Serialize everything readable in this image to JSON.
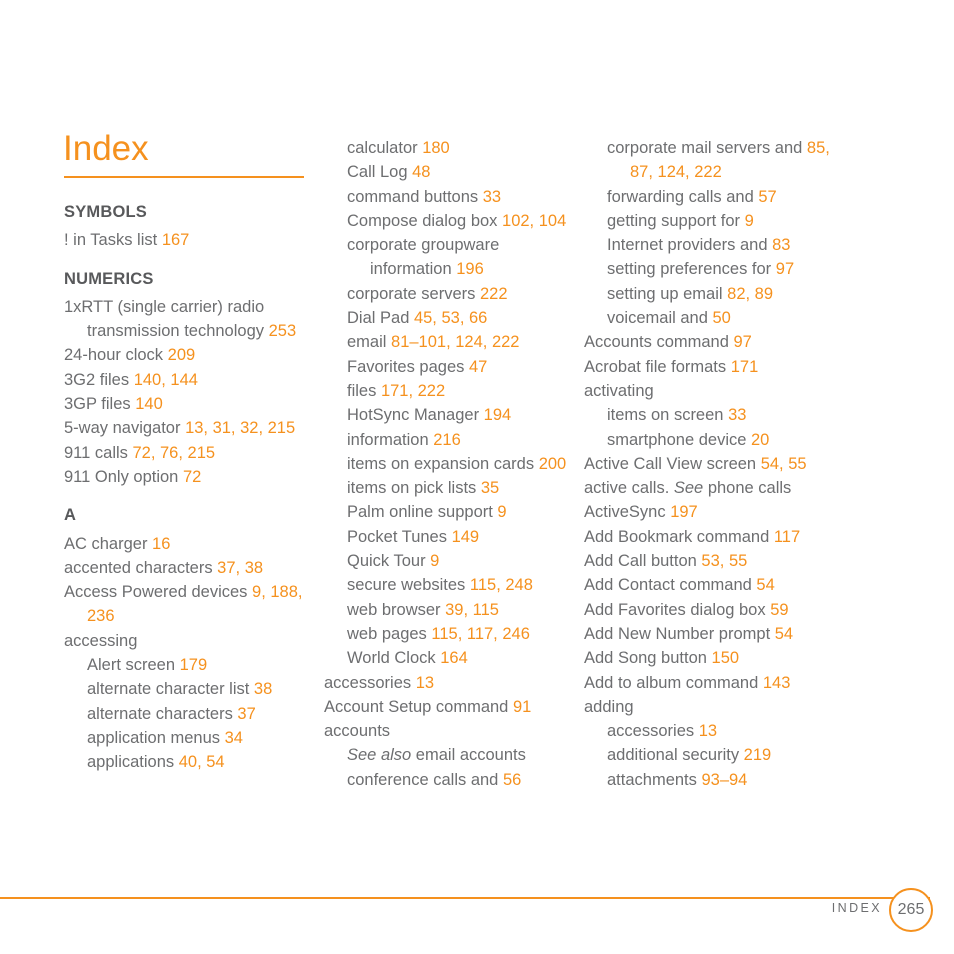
{
  "page": {
    "title": "Index",
    "accent_color": "#f5911e",
    "body_color": "#6d6e70",
    "head_color": "#58595b",
    "background": "#ffffff"
  },
  "footer": {
    "label": "INDEX",
    "page_number": "265"
  },
  "columns": [
    {
      "id": "column-1",
      "blocks": [
        {
          "type": "section",
          "label": "SYMBOLS"
        },
        {
          "type": "entry",
          "level": 0,
          "text": "! in Tasks list ",
          "pages": "167"
        },
        {
          "type": "section",
          "label": "NUMERICS"
        },
        {
          "type": "entry",
          "level": 0,
          "text": "1xRTT (single carrier) radio transmission technology ",
          "pages": "253"
        },
        {
          "type": "entry",
          "level": 0,
          "text": "24-hour clock ",
          "pages": "209"
        },
        {
          "type": "entry",
          "level": 0,
          "text": "3G2 files ",
          "pages": "140, 144"
        },
        {
          "type": "entry",
          "level": 0,
          "text": "3GP files ",
          "pages": "140"
        },
        {
          "type": "entry",
          "level": 0,
          "text": "5-way navigator ",
          "pages": "13, 31, 32, 215"
        },
        {
          "type": "entry",
          "level": 0,
          "text": "911 calls ",
          "pages": "72, 76, 215"
        },
        {
          "type": "entry",
          "level": 0,
          "text": "911 Only option ",
          "pages": "72"
        },
        {
          "type": "section",
          "label": "A"
        },
        {
          "type": "entry",
          "level": 0,
          "text": "AC charger ",
          "pages": "16"
        },
        {
          "type": "entry",
          "level": 0,
          "text": "accented characters ",
          "pages": "37, 38"
        },
        {
          "type": "entry",
          "level": 0,
          "text": "Access Powered devices ",
          "pages": "9, 188, 236"
        },
        {
          "type": "entry",
          "level": 0,
          "text": "accessing",
          "pages": ""
        },
        {
          "type": "entry",
          "level": 1,
          "text": "Alert screen ",
          "pages": "179"
        },
        {
          "type": "entry",
          "level": 1,
          "text": "alternate character list ",
          "pages": "38"
        },
        {
          "type": "entry",
          "level": 1,
          "text": "alternate characters ",
          "pages": "37"
        },
        {
          "type": "entry",
          "level": 1,
          "text": "application menus ",
          "pages": "34"
        },
        {
          "type": "entry",
          "level": 1,
          "text": "applications ",
          "pages": "40, 54"
        }
      ]
    },
    {
      "id": "column-2",
      "blocks": [
        {
          "type": "entry",
          "level": 1,
          "text": "calculator ",
          "pages": "180"
        },
        {
          "type": "entry",
          "level": 1,
          "text": "Call Log ",
          "pages": "48"
        },
        {
          "type": "entry",
          "level": 1,
          "text": "command buttons ",
          "pages": "33"
        },
        {
          "type": "entry",
          "level": 1,
          "text": "Compose dialog box ",
          "pages": "102, 104"
        },
        {
          "type": "entry",
          "level": 1,
          "text": "corporate groupware information ",
          "pages": "196"
        },
        {
          "type": "entry",
          "level": 1,
          "text": "corporate servers ",
          "pages": "222"
        },
        {
          "type": "entry",
          "level": 1,
          "text": "Dial Pad ",
          "pages": "45, 53, 66"
        },
        {
          "type": "entry",
          "level": 1,
          "text": "email ",
          "pages": "81–101, 124, 222"
        },
        {
          "type": "entry",
          "level": 1,
          "text": "Favorites pages ",
          "pages": "47"
        },
        {
          "type": "entry",
          "level": 1,
          "text": "files ",
          "pages": "171, 222"
        },
        {
          "type": "entry",
          "level": 1,
          "text": "HotSync Manager ",
          "pages": "194"
        },
        {
          "type": "entry",
          "level": 1,
          "text": "information ",
          "pages": "216"
        },
        {
          "type": "entry",
          "level": 1,
          "text": "items on expansion cards ",
          "pages": "200"
        },
        {
          "type": "entry",
          "level": 1,
          "text": "items on pick lists ",
          "pages": "35"
        },
        {
          "type": "entry",
          "level": 1,
          "text": "Palm online support ",
          "pages": "9"
        },
        {
          "type": "entry",
          "level": 1,
          "text": "Pocket Tunes ",
          "pages": "149"
        },
        {
          "type": "entry",
          "level": 1,
          "text": "Quick Tour ",
          "pages": "9"
        },
        {
          "type": "entry",
          "level": 1,
          "text": "secure websites ",
          "pages": "115, 248"
        },
        {
          "type": "entry",
          "level": 1,
          "text": "web browser ",
          "pages": "39, 115"
        },
        {
          "type": "entry",
          "level": 1,
          "text": "web pages ",
          "pages": "115, 117, 246"
        },
        {
          "type": "entry",
          "level": 1,
          "text": "World Clock ",
          "pages": "164"
        },
        {
          "type": "entry",
          "level": 0,
          "text": "accessories ",
          "pages": "13"
        },
        {
          "type": "entry",
          "level": 0,
          "text": "Account Setup command ",
          "pages": "91"
        },
        {
          "type": "entry",
          "level": 0,
          "text": "accounts",
          "pages": ""
        },
        {
          "type": "entry",
          "level": 1,
          "italic_prefix": "See also",
          "text": " email accounts",
          "pages": ""
        },
        {
          "type": "entry",
          "level": 1,
          "text": "conference calls and ",
          "pages": "56"
        }
      ]
    },
    {
      "id": "column-3",
      "blocks": [
        {
          "type": "entry",
          "level": 1,
          "text": "corporate mail servers and ",
          "pages": "85, 87, 124, 222"
        },
        {
          "type": "entry",
          "level": 1,
          "text": "forwarding calls and ",
          "pages": "57"
        },
        {
          "type": "entry",
          "level": 1,
          "text": "getting support for ",
          "pages": "9"
        },
        {
          "type": "entry",
          "level": 1,
          "text": "Internet providers and ",
          "pages": "83"
        },
        {
          "type": "entry",
          "level": 1,
          "text": "setting preferences for ",
          "pages": "97"
        },
        {
          "type": "entry",
          "level": 1,
          "text": "setting up email ",
          "pages": "82, 89"
        },
        {
          "type": "entry",
          "level": 1,
          "text": "voicemail and ",
          "pages": "50"
        },
        {
          "type": "entry",
          "level": 0,
          "text": "Accounts command ",
          "pages": "97"
        },
        {
          "type": "entry",
          "level": 0,
          "text": "Acrobat file formats ",
          "pages": "171"
        },
        {
          "type": "entry",
          "level": 0,
          "text": "activating",
          "pages": ""
        },
        {
          "type": "entry",
          "level": 1,
          "text": "items on screen ",
          "pages": "33"
        },
        {
          "type": "entry",
          "level": 1,
          "text": "smartphone device ",
          "pages": "20"
        },
        {
          "type": "entry",
          "level": 0,
          "text": "Active Call View screen ",
          "pages": "54, 55"
        },
        {
          "type": "entry",
          "level": 0,
          "text": "active calls. ",
          "italic_mid": "See",
          "text_after": " phone calls",
          "pages": ""
        },
        {
          "type": "entry",
          "level": 0,
          "text": "ActiveSync ",
          "pages": "197"
        },
        {
          "type": "entry",
          "level": 0,
          "text": "Add Bookmark command ",
          "pages": "117"
        },
        {
          "type": "entry",
          "level": 0,
          "text": "Add Call button ",
          "pages": "53, 55"
        },
        {
          "type": "entry",
          "level": 0,
          "text": "Add Contact command ",
          "pages": "54"
        },
        {
          "type": "entry",
          "level": 0,
          "text": "Add Favorites dialog box ",
          "pages": "59"
        },
        {
          "type": "entry",
          "level": 0,
          "text": "Add New Number prompt ",
          "pages": "54"
        },
        {
          "type": "entry",
          "level": 0,
          "text": "Add Song button ",
          "pages": "150"
        },
        {
          "type": "entry",
          "level": 0,
          "text": "Add to album command ",
          "pages": "143"
        },
        {
          "type": "entry",
          "level": 0,
          "text": "adding",
          "pages": ""
        },
        {
          "type": "entry",
          "level": 1,
          "text": "accessories ",
          "pages": "13"
        },
        {
          "type": "entry",
          "level": 1,
          "text": "additional security ",
          "pages": "219"
        },
        {
          "type": "entry",
          "level": 1,
          "text": "attachments ",
          "pages": "93–94"
        }
      ]
    }
  ]
}
